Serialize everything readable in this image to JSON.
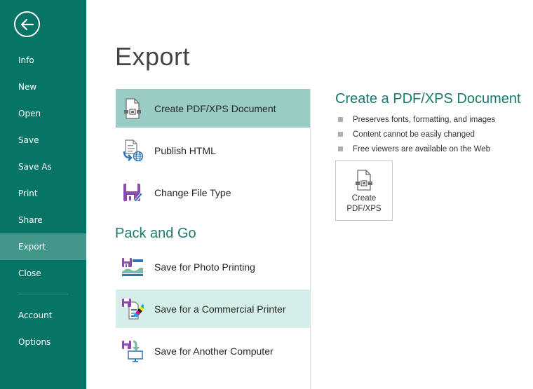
{
  "sidebar": {
    "back_icon": "back-arrow-icon",
    "items": [
      {
        "label": "Info"
      },
      {
        "label": "New"
      },
      {
        "label": "Open"
      },
      {
        "label": "Save"
      },
      {
        "label": "Save As"
      },
      {
        "label": "Print"
      },
      {
        "label": "Share"
      },
      {
        "label": "Export",
        "active": true
      },
      {
        "label": "Close"
      },
      {
        "label": "Account"
      },
      {
        "label": "Options"
      }
    ]
  },
  "page": {
    "title": "Export"
  },
  "export_options": [
    {
      "label": "Create PDF/XPS Document",
      "icon": "pdf-document-icon",
      "state": "selected"
    },
    {
      "label": "Publish HTML",
      "icon": "publish-html-icon"
    },
    {
      "label": "Change File Type",
      "icon": "change-file-type-icon"
    }
  ],
  "pack_and_go": {
    "heading": "Pack and Go",
    "options": [
      {
        "label": "Save for Photo Printing",
        "icon": "photo-printing-icon"
      },
      {
        "label": "Save for a Commercial Printer",
        "icon": "commercial-printer-icon",
        "state": "hover"
      },
      {
        "label": "Save for Another Computer",
        "icon": "another-computer-icon"
      }
    ]
  },
  "detail": {
    "title": "Create a PDF/XPS Document",
    "bullets": [
      "Preserves fonts, formatting, and images",
      "Content cannot be easily changed",
      "Free viewers are available on the Web"
    ],
    "button": {
      "line1": "Create",
      "line2": "PDF/XPS",
      "icon": "pdf-document-icon"
    }
  },
  "colors": {
    "sidebar_bg": "#077565",
    "sidebar_active": "#43978A",
    "selected_bg": "#98CCC5",
    "hover_bg": "#D5EEEA",
    "accent_text": "#1A7A6C"
  }
}
